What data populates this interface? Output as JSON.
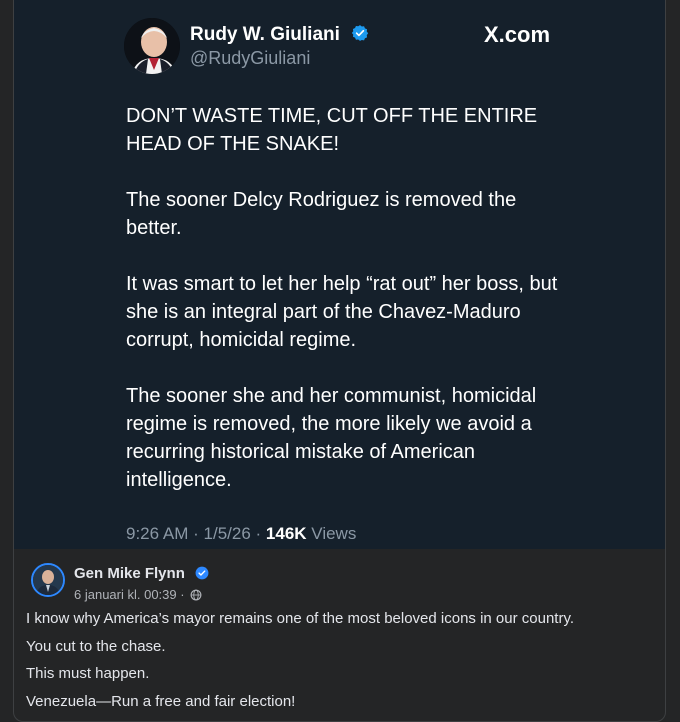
{
  "tweet": {
    "author_name": "Rudy W. Giuliani",
    "handle": "@RudyGiuliani",
    "site": "X.com",
    "paragraphs": [
      "DON’T WASTE TIME, CUT OFF THE ENTIRE HEAD OF THE SNAKE!",
      "The sooner Delcy Rodriguez is removed the better.",
      "It was smart to let her help “rat out” her boss, but she is an integral part of the Chavez-Maduro corrupt, homicidal regime.",
      "The sooner she and her communist, homicidal regime is removed, the more likely we avoid a recurring historical mistake of American intelligence."
    ],
    "time": "9:26 AM",
    "date": "1/5/26",
    "views_count": "146K",
    "views_label": "Views",
    "separator": "·"
  },
  "comment": {
    "author_name": "Gen Mike Flynn",
    "date": "6 januari kl. 00:39",
    "date_separator": "·",
    "lines": [
      "I know why America’s mayor remains one of the most beloved icons in our country.",
      "You cut to the chase.",
      "This must happen.",
      "Venezuela—Run a free and fair election!"
    ]
  },
  "colors": {
    "tweet_background": "#15202b",
    "verified_blue": "#1d9bf0",
    "page_background": "#242526",
    "facebook_blue": "#2d88ff"
  },
  "icons": {
    "tweet_verified": "verified-badge-icon",
    "comment_verified": "verified-badge-icon",
    "audience": "globe-icon"
  }
}
